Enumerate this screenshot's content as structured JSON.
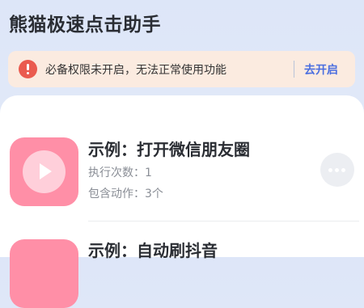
{
  "header": {
    "title": "熊猫极速点击助手"
  },
  "permission_warning": {
    "icon": "alert-icon",
    "message": "必备权限未开启，无法正常使用功能",
    "action_label": "去开启",
    "accent_color": "#4b6fe0",
    "alert_color": "#ea5b4f"
  },
  "tasks": [
    {
      "icon": "play-icon",
      "title": "示例：打开微信朋友圈",
      "runs": "执行次数：1",
      "actions": "包含动作：3个"
    },
    {
      "icon": "play-icon",
      "title": "示例：自动刷抖音"
    }
  ]
}
